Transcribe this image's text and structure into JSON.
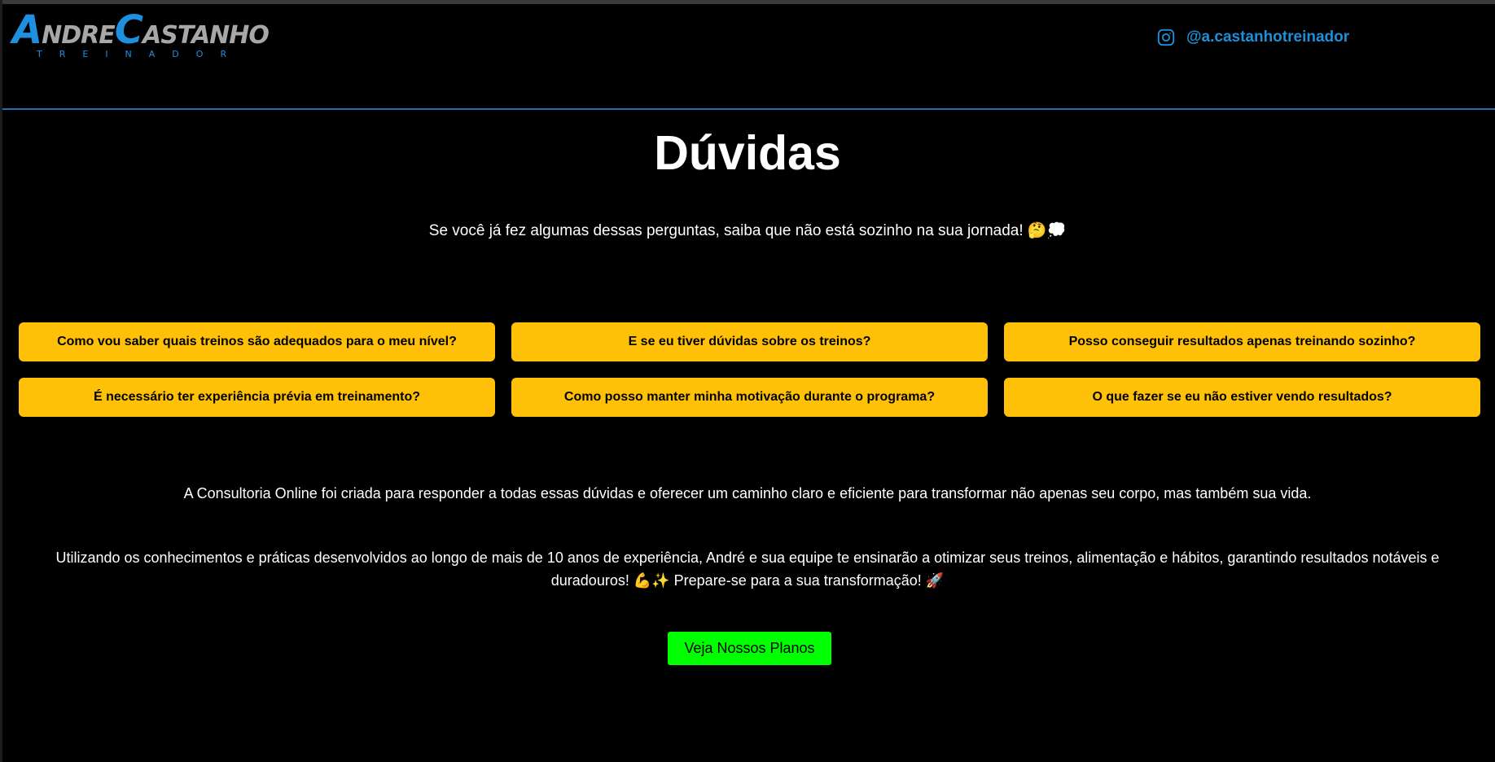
{
  "header": {
    "logo": {
      "first_initial": "A",
      "first_rest": "NDRE",
      "second_initial": "C",
      "second_rest": "ASTANHO",
      "subtitle": "TREINADOR"
    },
    "instagram": {
      "handle": "@a.castanhotreinador",
      "icon": "instagram-icon",
      "color": "#1e8fd6"
    }
  },
  "main": {
    "title": "Dúvidas",
    "subtitle": "Se você já fez algumas dessas perguntas, saiba que não está sozinho na sua jornada! 🤔💭",
    "questions": [
      "Como vou saber quais treinos são adequados para o meu nível?",
      "E se eu tiver dúvidas sobre os treinos?",
      "Posso conseguir resultados apenas treinando sozinho?",
      "É necessário ter experiência prévia em treinamento?",
      "Como posso manter minha motivação durante o programa?",
      "O que fazer se eu não estiver vendo resultados?"
    ],
    "paragraph1": "A Consultoria Online foi criada para responder a todas essas dúvidas e oferecer um caminho claro e eficiente para transformar não apenas seu corpo, mas também sua vida.",
    "paragraph2": "Utilizando os conhecimentos e práticas desenvolvidos ao longo de mais de 10 anos de experiência, André e sua equipe te ensinarão a otimizar seus treinos, alimentação e hábitos, garantindo resultados notáveis e duradouros! 💪✨ Prepare-se para a sua transformação! 🚀",
    "cta_label": "Veja Nossos Planos"
  },
  "colors": {
    "background": "#000000",
    "accent_blue": "#1e90e0",
    "question_button": "#ffc107",
    "cta_button": "#00ff00"
  }
}
